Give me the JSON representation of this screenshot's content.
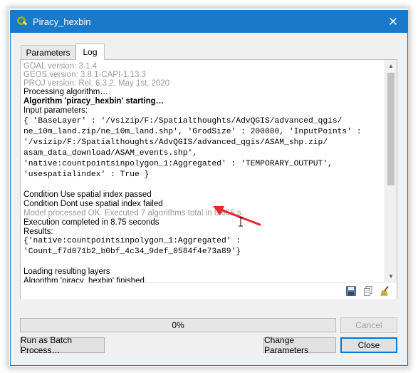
{
  "window": {
    "title": "Piracy_hexbin",
    "close_glyph": "✕"
  },
  "tabs": [
    {
      "label": "Parameters",
      "active": false
    },
    {
      "label": "Log",
      "active": true
    }
  ],
  "log": {
    "lines": [
      {
        "text": "GDAL version: 3.1.4",
        "style": "gray"
      },
      {
        "text": "GEOS version: 3.8.1-CAPI-1.13.3",
        "style": "gray"
      },
      {
        "text": "PROJ version: Rel. 6.3.2, May 1st, 2020",
        "style": "gray"
      },
      {
        "text": "Processing algorithm…",
        "style": "normal"
      },
      {
        "text": "Algorithm 'piracy_hexbin' starting…",
        "style": "bold"
      },
      {
        "text": "Input parameters:",
        "style": "normal"
      },
      {
        "text": "{ 'BaseLayer' : '/vsizip/F:/Spatialthoughts/AdvQGIS/advanced_qgis/",
        "style": "mono"
      },
      {
        "text": "ne_10m_land.zip/ne_10m_land.shp', 'GrodSize' : 200000, 'InputPoints' :",
        "style": "mono"
      },
      {
        "text": "'/vsizip/F:/Spatialthoughts/AdvQGIS/advanced_qgis/ASAM_shp.zip/",
        "style": "mono"
      },
      {
        "text": "asam_data_download/ASAM_events.shp',",
        "style": "mono"
      },
      {
        "text": "'native:countpointsinpolygon_1:Aggregated' : 'TEMPORARY_OUTPUT',",
        "style": "mono"
      },
      {
        "text": "'usespatialindex' : True }",
        "style": "mono"
      },
      {
        "text": "",
        "style": "normal"
      },
      {
        "text": "Condition Use spatial index passed",
        "style": "normal"
      },
      {
        "text": "Condition Dont use spatial index failed",
        "style": "normal"
      },
      {
        "text": "Model processed OK. Executed 7 algorithms total in 8.665 s.",
        "style": "gray"
      },
      {
        "text": "Execution completed in 8.75 seconds",
        "style": "normal"
      },
      {
        "text": "Results:",
        "style": "normal"
      },
      {
        "text": "{'native:countpointsinpolygon_1:Aggregated' :",
        "style": "mono"
      },
      {
        "text": "'Count_f7d071b2_b0bf_4c34_9def_0584f4e73a89'}",
        "style": "mono"
      },
      {
        "text": "",
        "style": "normal"
      },
      {
        "text": "Loading resulting layers",
        "style": "normal"
      },
      {
        "text": "Algorithm 'piracy_hexbin' finished",
        "style": "normal"
      }
    ]
  },
  "toolbar_icons": [
    "save-log-icon",
    "copy-log-icon",
    "clear-log-icon"
  ],
  "progress": {
    "label": "0%",
    "value": 0
  },
  "buttons": {
    "cancel": "Cancel",
    "batch": "Run as Batch Process…",
    "change_params": "Change Parameters",
    "close": "Close"
  },
  "colors": {
    "title_bar": "#1979ca",
    "annotation_arrow": "#e8262b"
  }
}
